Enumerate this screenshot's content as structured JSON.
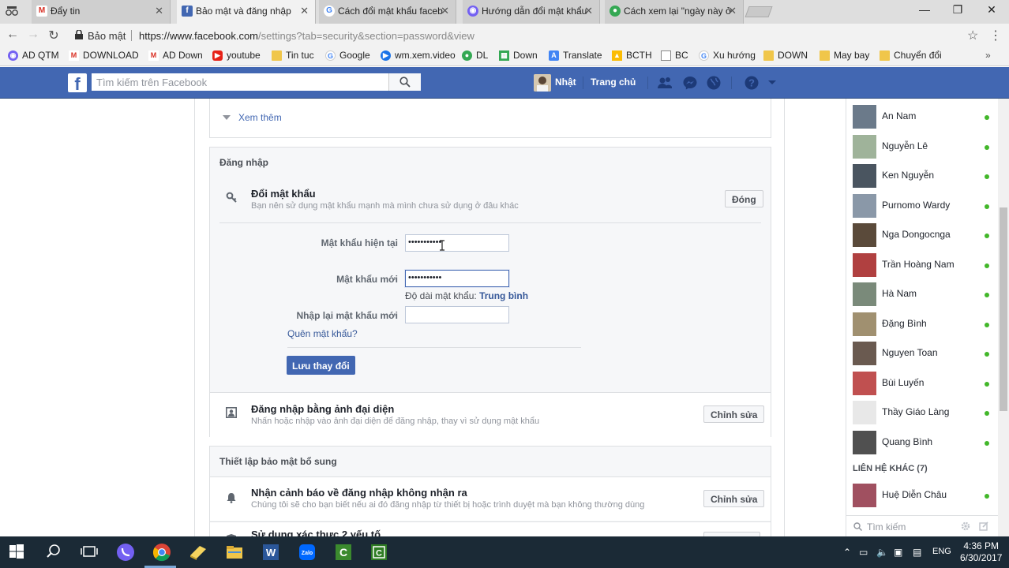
{
  "browser": {
    "tabs": [
      {
        "title": "Đẩy tin",
        "icon": "gmail-icon",
        "icon_color": "#d93025"
      },
      {
        "title": "Bảo mật và đăng nhập",
        "icon": "facebook-icon",
        "icon_color": "#4267b2"
      },
      {
        "title": "Cách đổi mật khẩu faceb",
        "icon": "google-icon",
        "icon_color": "#4285f4"
      },
      {
        "title": "Hướng dẫn đổi mật khẩu",
        "icon": "viber-icon",
        "icon_color": "#7360f2"
      },
      {
        "title": "Cách xem lại \"ngày này ở",
        "icon": "chrome-icon",
        "icon_color": "#34a853"
      }
    ],
    "active_tab": 1,
    "secure_label": "Bảo mật",
    "url_main": "https://www.facebook.com",
    "url_rest": "/settings?tab=security&section=password&view"
  },
  "bookmarks": [
    {
      "label": "AD QTM",
      "icon": "viber-icon",
      "color": "#7360f2"
    },
    {
      "label": "DOWNLOAD",
      "icon": "gmail-icon",
      "color": "#d93025"
    },
    {
      "label": "AD Down",
      "icon": "gmail-icon",
      "color": "#d93025"
    },
    {
      "label": "youtube",
      "icon": "youtube-icon",
      "color": "#e62117"
    },
    {
      "label": "Tin tuc",
      "icon": "folder-icon",
      "color": "#f0c64a"
    },
    {
      "label": "Google",
      "icon": "google-icon",
      "color": "#4285f4"
    },
    {
      "label": "wm.xem.video",
      "icon": "play-icon",
      "color": "#1a73e8"
    },
    {
      "label": "DL",
      "icon": "chrome-icon",
      "color": "#34a853"
    },
    {
      "label": "Down",
      "icon": "grid-icon",
      "color": "#34a853"
    },
    {
      "label": "Translate",
      "icon": "translate-icon",
      "color": "#4285f4"
    },
    {
      "label": "BCTH",
      "icon": "drive-icon",
      "color": "#fbbc04"
    },
    {
      "label": "BC",
      "icon": "page-icon",
      "color": "#ffffff"
    },
    {
      "label": "Xu hướng",
      "icon": "google-icon",
      "color": "#4285f4"
    },
    {
      "label": "DOWN",
      "icon": "folder-icon",
      "color": "#f0c64a"
    },
    {
      "label": "May bay",
      "icon": "folder-icon",
      "color": "#f0c64a"
    },
    {
      "label": "Chuyển đổi",
      "icon": "folder-icon",
      "color": "#f0c64a"
    }
  ],
  "fb_header": {
    "search_placeholder": "Tìm kiếm trên Facebook",
    "user_name": "Nhật",
    "home_label": "Trang chủ",
    "brand_color": "#4267b2"
  },
  "settings": {
    "see_more": "Xem thêm",
    "login_section": "Đăng nhập",
    "change_password": {
      "title": "Đổi mật khẩu",
      "desc": "Bạn nên sử dụng mật khẩu mạnh mà mình chưa sử dụng ở đâu khác",
      "close_label": "Đóng",
      "current_label": "Mật khẩu hiện tại",
      "current_value": "•••••••••••",
      "new_label": "Mật khẩu mới",
      "new_value": "•••••••••••",
      "strength_label": "Độ dài mật khẩu:",
      "strength_value": "Trung bình",
      "retype_label": "Nhập lại mật khẩu mới",
      "retype_value": "",
      "forgot": "Quên mật khẩu?",
      "save": "Lưu thay đổi"
    },
    "profile_login": {
      "title": "Đăng nhập bằng ảnh đại diện",
      "desc": "Nhấn hoặc nhập vào ảnh đại diện để đăng nhập, thay vì sử dụng mật khẩu",
      "edit": "Chỉnh sửa"
    },
    "extra_section": "Thiết lập bảo mật bổ sung",
    "alerts": {
      "title": "Nhận cảnh báo về đăng nhập không nhận ra",
      "desc": "Chúng tôi sẽ cho bạn biết nếu ai đó đăng nhập từ thiết bị hoặc trình duyệt mà bạn không thường dùng",
      "edit": "Chỉnh sửa"
    },
    "two_factor": {
      "title": "Sử dụng xác thực 2 yếu tố"
    }
  },
  "chat": {
    "contacts": [
      {
        "name": "An Nam",
        "color": "#6b7a8a"
      },
      {
        "name": "Nguyễn Lê",
        "color": "#9fb39a"
      },
      {
        "name": "Ken Nguyễn",
        "color": "#4a5560"
      },
      {
        "name": "Purnomo Wardy",
        "color": "#8a98a8"
      },
      {
        "name": "Nga Dongocnga",
        "color": "#5a4a3a"
      },
      {
        "name": "Trần Hoàng Nam",
        "color": "#b04040"
      },
      {
        "name": "Hà Nam",
        "color": "#7a8a7a"
      },
      {
        "name": "Đặng Bình",
        "color": "#a09070"
      },
      {
        "name": "Nguyen Toan",
        "color": "#6a5a50"
      },
      {
        "name": "Bùi Luyến",
        "color": "#c05050"
      },
      {
        "name": "Thầy Giáo Làng",
        "color": "#e8e8e8"
      },
      {
        "name": "Quang Bình",
        "color": "#505050"
      }
    ],
    "other_header": "LIÊN HỆ KHÁC (7)",
    "other_contacts": [
      {
        "name": "Huệ Diễn Châu",
        "color": "#a05060"
      }
    ],
    "search_placeholder": "Tìm kiếm",
    "online_color": "#42b72a"
  },
  "taskbar": {
    "language": "ENG",
    "time": "4:36 PM",
    "date": "6/30/2017"
  }
}
